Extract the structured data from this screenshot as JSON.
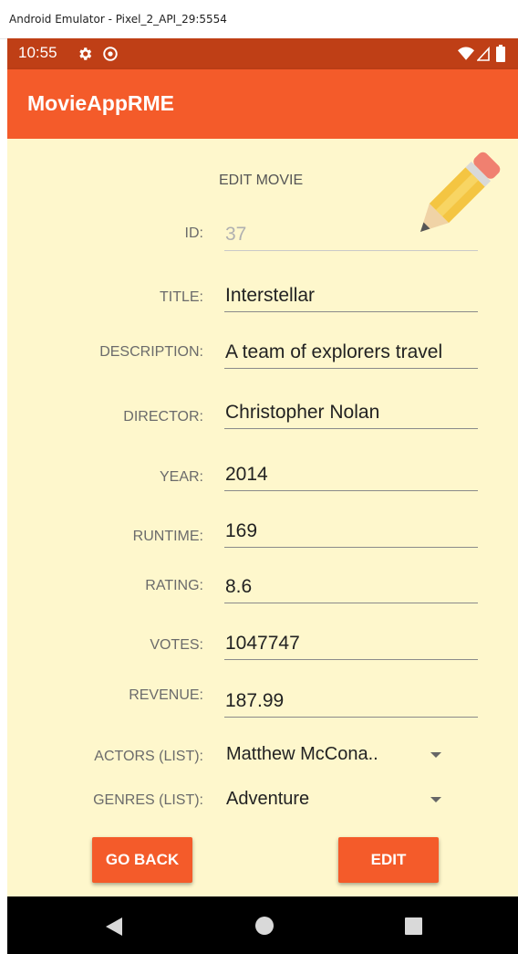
{
  "window": {
    "title": "Android Emulator - Pixel_2_API_29:5554"
  },
  "status_bar": {
    "time": "10:55",
    "color": "#bf3f16"
  },
  "app_bar": {
    "title": "MovieAppRME",
    "color": "#f45b2a"
  },
  "form": {
    "heading": "EDIT MOVIE",
    "background": "#fef7cc",
    "id": {
      "label": "ID:",
      "value": "37"
    },
    "title": {
      "label": "TITLE:",
      "value": "Interstellar"
    },
    "description": {
      "label": "DESCRIPTION:",
      "value": "A team of explorers travel"
    },
    "director": {
      "label": "DIRECTOR:",
      "value": "Christopher Nolan"
    },
    "year": {
      "label": "YEAR:",
      "value": "2014"
    },
    "runtime": {
      "label": "RUNTIME:",
      "value": "169"
    },
    "rating": {
      "label": "RATING:",
      "value": "8.6"
    },
    "votes": {
      "label": "VOTES:",
      "value": "1047747"
    },
    "revenue": {
      "label": "REVENUE:",
      "value": "187.99"
    },
    "actors": {
      "label": "ACTORS (LIST):",
      "selected": "Matthew McCona.."
    },
    "genres": {
      "label": "GENRES (LIST):",
      "selected": "Adventure"
    }
  },
  "buttons": {
    "go_back": "GO BACK",
    "edit": "EDIT"
  },
  "icons": {
    "header_icon": "pencil-icon",
    "status": [
      "gear-icon",
      "circle-at-icon",
      "wifi-icon",
      "signal-icon",
      "battery-icon"
    ],
    "nav": [
      "back-icon",
      "home-icon",
      "recents-icon"
    ]
  }
}
